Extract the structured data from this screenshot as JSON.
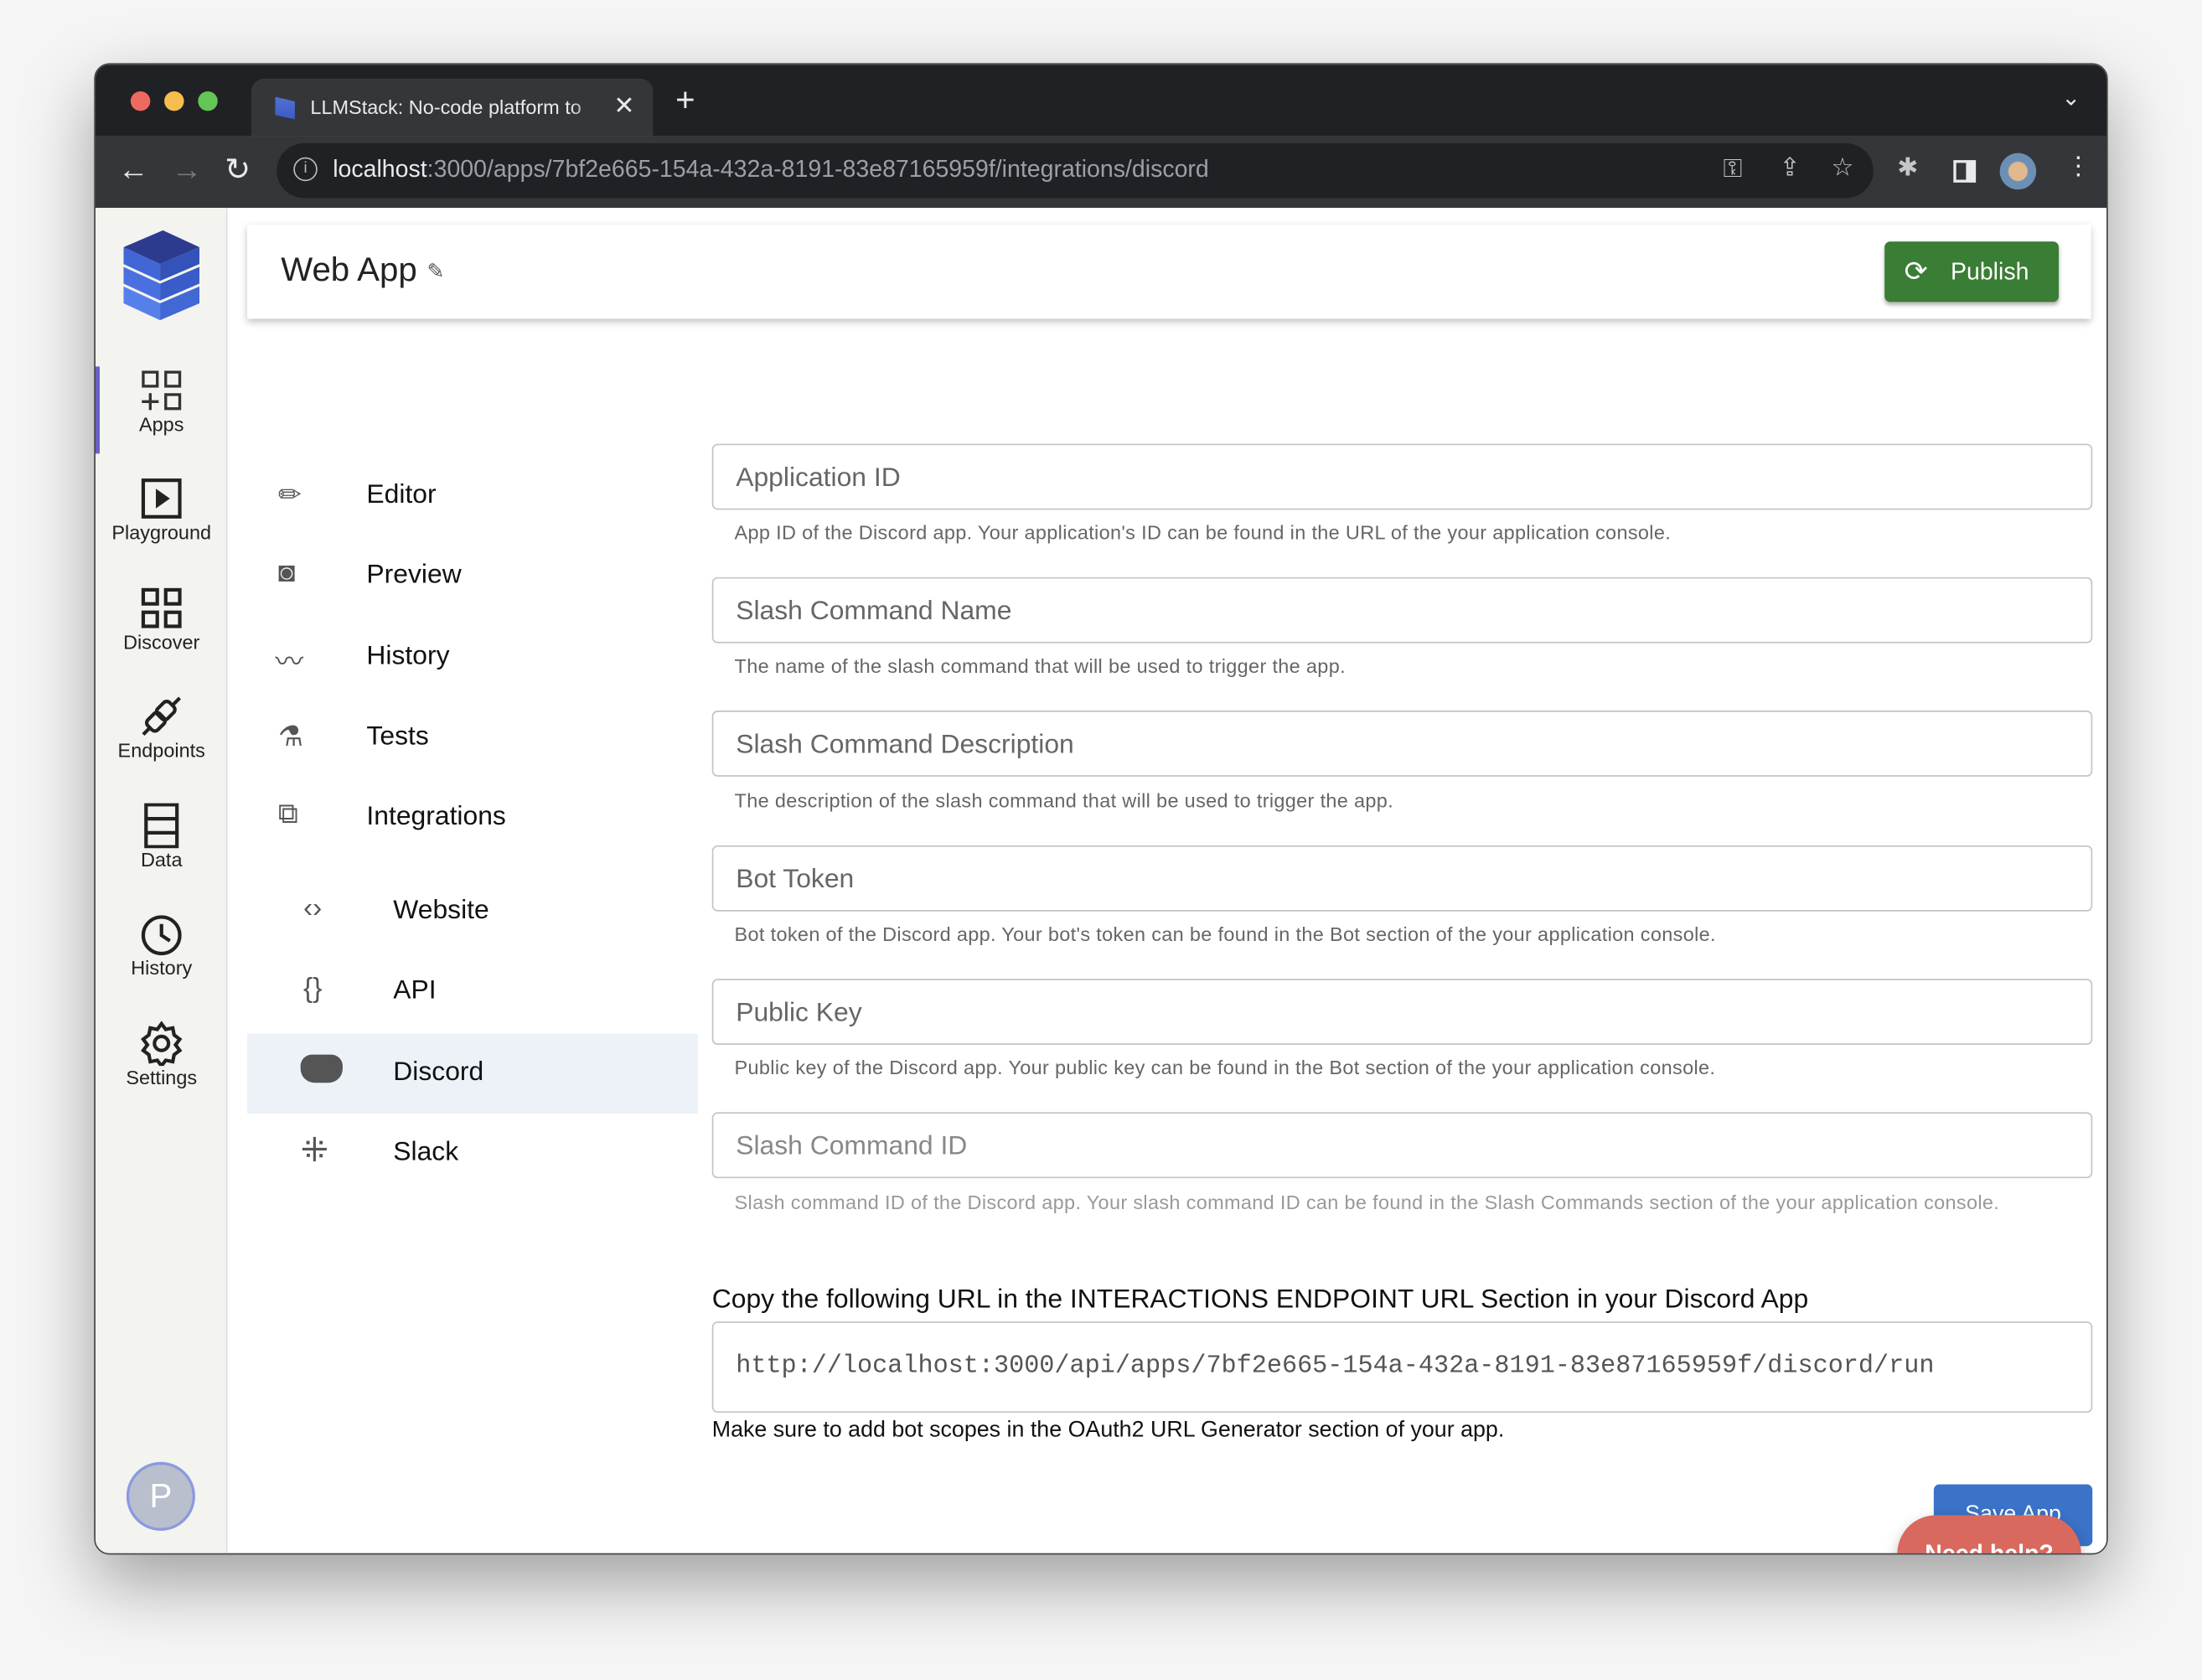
{
  "browser": {
    "tab_title": "LLMStack: No-code platform to",
    "url_host": "localhost",
    "url_path": ":3000/apps/7bf2e665-154a-432a-8191-83e87165959f/integrations/discord"
  },
  "sidebar": {
    "items": [
      {
        "label": "Apps",
        "icon": "apps-icon"
      },
      {
        "label": "Playground",
        "icon": "play-icon"
      },
      {
        "label": "Discover",
        "icon": "grid-icon"
      },
      {
        "label": "Endpoints",
        "icon": "plug-icon"
      },
      {
        "label": "Data",
        "icon": "database-icon"
      },
      {
        "label": "History",
        "icon": "clock-icon"
      },
      {
        "label": "Settings",
        "icon": "gear-icon"
      }
    ],
    "avatar": "P",
    "active_color": "#6b5fc7"
  },
  "header": {
    "title": "Web App",
    "publish": "Publish",
    "publish_color": "#3a7d34"
  },
  "nav": {
    "items": [
      {
        "label": "Editor"
      },
      {
        "label": "Preview"
      },
      {
        "label": "History"
      },
      {
        "label": "Tests"
      },
      {
        "label": "Integrations"
      }
    ],
    "sub": [
      {
        "label": "Website"
      },
      {
        "label": "API"
      },
      {
        "label": "Discord"
      },
      {
        "label": "Slack"
      }
    ]
  },
  "form": {
    "fields": [
      {
        "label": "Application ID",
        "help": "App ID of the Discord app. Your application's ID can be found in the URL of the your application console."
      },
      {
        "label": "Slash Command Name",
        "help": "The name of the slash command that will be used to trigger the app."
      },
      {
        "label": "Slash Command Description",
        "help": "The description of the slash command that will be used to trigger the app."
      },
      {
        "label": "Bot Token",
        "help": "Bot token of the Discord app. Your bot's token can be found in the Bot section of the your application console."
      },
      {
        "label": "Public Key",
        "help": "Public key of the Discord app. Your public key can be found in the Bot section of the your application console."
      },
      {
        "label": "Slash Command ID",
        "help": "Slash command ID of the Discord app. Your slash command ID can be found in the Slash Commands section of the your application console."
      }
    ],
    "copy_text": "Copy the following URL in the INTERACTIONS ENDPOINT URL Section in your Discord App",
    "endpoint_url": "http://localhost:3000/api/apps/7bf2e665-154a-432a-8191-83e87165959f/discord/run",
    "note": "Make sure to add bot scopes in the OAuth2 URL Generator section of your app.",
    "save": "Save App",
    "help_button": "Need help?"
  }
}
